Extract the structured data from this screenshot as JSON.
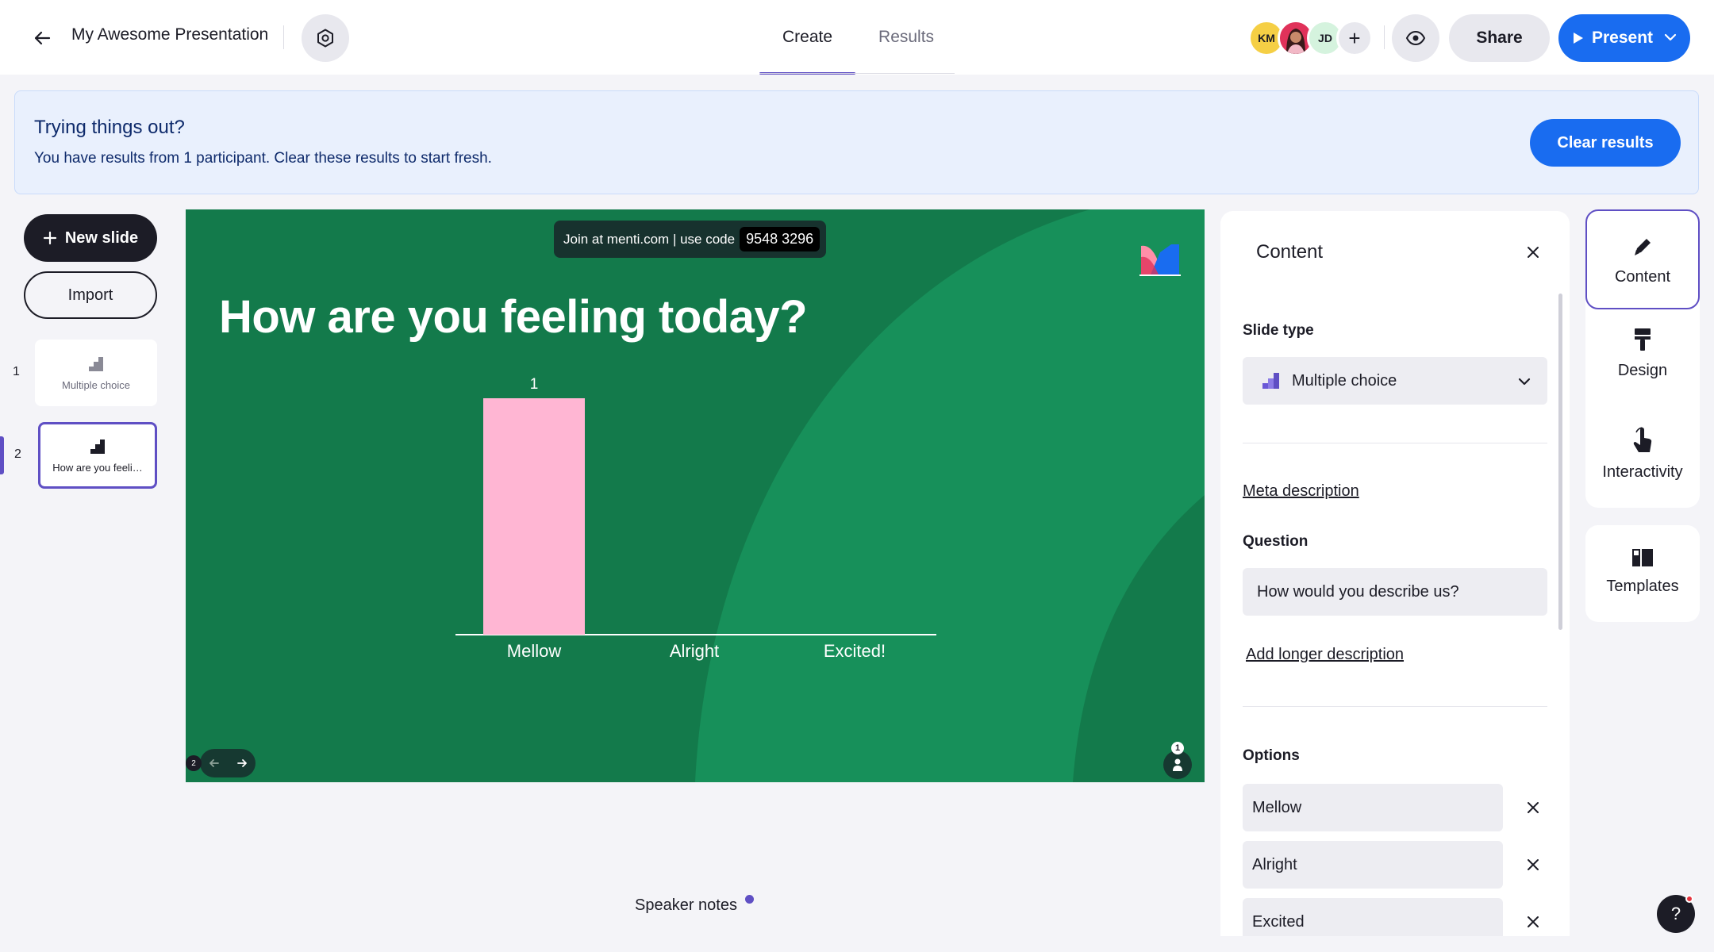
{
  "header": {
    "title": "My Awesome Presentation",
    "tabs": [
      {
        "label": "Create",
        "active": true
      },
      {
        "label": "Results",
        "active": false
      }
    ],
    "avatars": [
      {
        "initials": "KM",
        "color": "#f5cf45"
      },
      {
        "initials": "",
        "color": "#e0325a",
        "icon": "user-photo"
      },
      {
        "initials": "JD",
        "color": "#d5f3de"
      }
    ],
    "add_collaborator": "+",
    "share_label": "Share",
    "present_label": "Present"
  },
  "banner": {
    "title": "Trying things out?",
    "text": "You have results from 1 participant. Clear these results to start fresh.",
    "button": "Clear results"
  },
  "sidebar": {
    "new_slide_label": "New slide",
    "import_label": "Import",
    "slides": [
      {
        "number": "1",
        "label": "Multiple choice",
        "selected": false
      },
      {
        "number": "2",
        "label": "How are you feeli…",
        "selected": true
      }
    ]
  },
  "slide": {
    "join_text": "Join at menti.com | use code",
    "join_code": "9548 3296",
    "title": "How are you feeling today?",
    "page_number": "2",
    "participant_count": "1"
  },
  "chart_data": {
    "type": "bar",
    "categories": [
      "Mellow",
      "Alright",
      "Excited!"
    ],
    "values": [
      1,
      0,
      0
    ],
    "data_labels": [
      "1",
      "",
      ""
    ],
    "colors": [
      "#ffb6d3",
      "#ffb6d3",
      "#ffb6d3"
    ],
    "ylim": [
      0,
      1
    ],
    "title": "",
    "xlabel": "",
    "ylabel": ""
  },
  "speaker_notes": "Speaker notes",
  "panel": {
    "title": "Content",
    "slide_type_label": "Slide type",
    "slide_type_value": "Multiple choice",
    "meta_description_link": "Meta description",
    "question_label": "Question",
    "question_value": "How would you describe us?",
    "add_description_link": "Add longer description",
    "options_label": "Options",
    "options": [
      "Mellow",
      "Alright",
      "Excited"
    ]
  },
  "rail": {
    "content": "Content",
    "design": "Design",
    "interactivity": "Interactivity",
    "templates": "Templates"
  },
  "help_label": "?",
  "colors": {
    "accent": "#5f4fc4",
    "primary": "#196cf0",
    "slide_bg": "#137a4b",
    "bar": "#ffb6d3"
  }
}
